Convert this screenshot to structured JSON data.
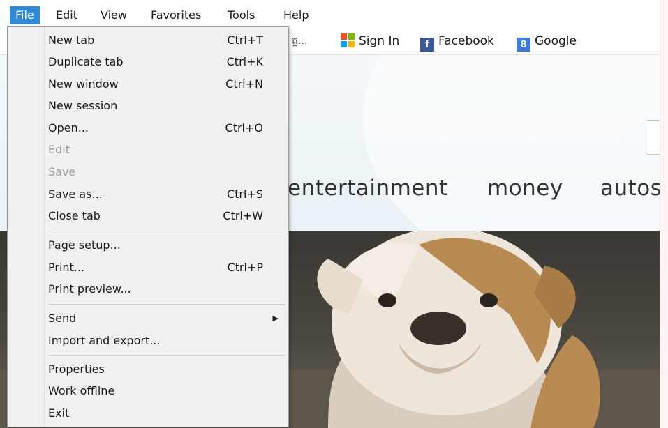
{
  "menubar": {
    "items": [
      "File",
      "Edit",
      "View",
      "Favorites",
      "Tools",
      "Help"
    ]
  },
  "favorites": {
    "truncated_label": "ត្ឋ...",
    "items": [
      {
        "label": "Sign In",
        "icon": "windows-logo-icon"
      },
      {
        "label": "Facebook",
        "icon": "facebook-icon"
      },
      {
        "label": "Google",
        "icon": "google-icon"
      }
    ]
  },
  "page": {
    "nav": [
      "entertainment",
      "money",
      "autos"
    ]
  },
  "file_menu": {
    "groups": [
      [
        {
          "label": "New tab",
          "shortcut": "Ctrl+T",
          "enabled": true
        },
        {
          "label": "Duplicate tab",
          "shortcut": "Ctrl+K",
          "enabled": true
        },
        {
          "label": "New window",
          "shortcut": "Ctrl+N",
          "enabled": true
        },
        {
          "label": "New session",
          "shortcut": "",
          "enabled": true
        },
        {
          "label": "Open...",
          "shortcut": "Ctrl+O",
          "enabled": true
        },
        {
          "label": "Edit",
          "shortcut": "",
          "enabled": false
        },
        {
          "label": "Save",
          "shortcut": "",
          "enabled": false
        },
        {
          "label": "Save as...",
          "shortcut": "Ctrl+S",
          "enabled": true
        },
        {
          "label": "Close tab",
          "shortcut": "Ctrl+W",
          "enabled": true
        }
      ],
      [
        {
          "label": "Page setup...",
          "shortcut": "",
          "enabled": true
        },
        {
          "label": "Print...",
          "shortcut": "Ctrl+P",
          "enabled": true
        },
        {
          "label": "Print preview...",
          "shortcut": "",
          "enabled": true
        }
      ],
      [
        {
          "label": "Send",
          "shortcut": "",
          "enabled": true,
          "submenu": true
        },
        {
          "label": "Import and export...",
          "shortcut": "",
          "enabled": true
        }
      ],
      [
        {
          "label": "Properties",
          "shortcut": "",
          "enabled": true
        },
        {
          "label": "Work offline",
          "shortcut": "",
          "enabled": true
        },
        {
          "label": "Exit",
          "shortcut": "",
          "enabled": true
        }
      ]
    ]
  },
  "colors": {
    "menu_highlight": "#2f8bd8",
    "menu_bg": "#f1f1f1",
    "disabled_text": "#9b9b9b"
  }
}
